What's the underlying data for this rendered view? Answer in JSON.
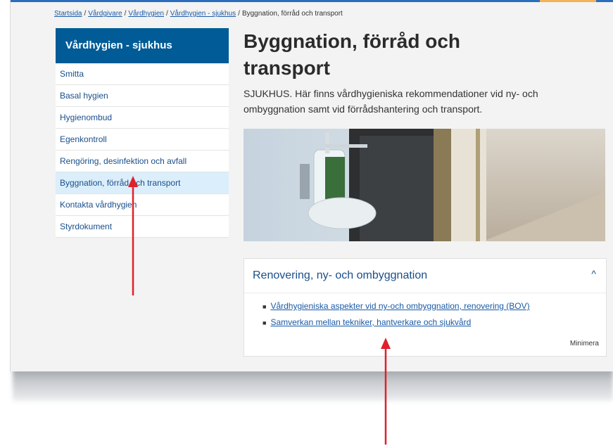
{
  "breadcrumb": {
    "items": [
      "Startsida",
      "Vårdgivare",
      "Vårdhygien",
      "Vårdhygien - sjukhus"
    ],
    "current": "Byggnation, förråd och transport",
    "separator": "/"
  },
  "sidebar": {
    "title": "Vårdhygien - sjukhus",
    "items": [
      {
        "label": "Smitta"
      },
      {
        "label": "Basal hygien"
      },
      {
        "label": "Hygienombud"
      },
      {
        "label": "Egenkontroll"
      },
      {
        "label": "Rengöring, desinfektion och avfall"
      },
      {
        "label": "Byggnation, förråd och transport",
        "active": true
      },
      {
        "label": "Kontakta vårdhygien"
      },
      {
        "label": "Styrdokument"
      }
    ]
  },
  "main": {
    "title_line1": "Byggnation, förråd och",
    "title_line2": "transport",
    "lead_line1": "SJUKHUS. Här finns vårdhygieniska rekommendationer vid ny- och",
    "lead_line2": "ombyggnation samt vid förrådshantering och transport."
  },
  "accordion": {
    "title": "Renovering, ny- och ombyggnation",
    "chevron": "^",
    "links": [
      "Vårdhygieniska aspekter vid ny-och ombyggnation, renovering (BOV)",
      "Samverkan mellan tekniker, hantverkare och sjukvård"
    ],
    "minimize": "Minimera"
  },
  "colors": {
    "brand_blue": "#005b96",
    "link_blue": "#1a5aa6",
    "active_bg": "#dbeefb",
    "arrow_red": "#e0202a"
  }
}
